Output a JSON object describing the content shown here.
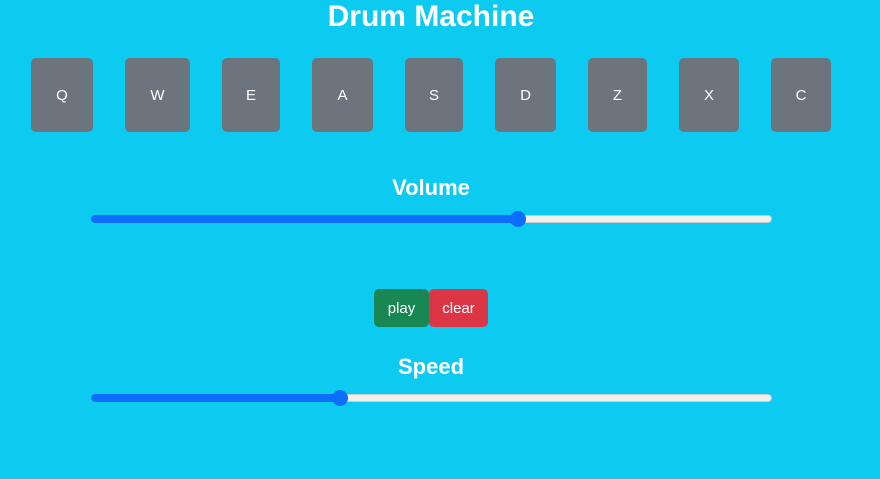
{
  "title": "Drum Machine",
  "pads": [
    {
      "key": "Q"
    },
    {
      "key": "W"
    },
    {
      "key": "E"
    },
    {
      "key": "A"
    },
    {
      "key": "S"
    },
    {
      "key": "D"
    },
    {
      "key": "Z"
    },
    {
      "key": "X"
    },
    {
      "key": "C"
    }
  ],
  "volume": {
    "label": "Volume",
    "value_fraction": 0.627
  },
  "controls": {
    "play_label": "play",
    "clear_label": "clear"
  },
  "speed": {
    "label": "Speed",
    "value_fraction": 0.366
  },
  "colors": {
    "background": "#0dcaf0",
    "pad": "#6c757d",
    "play": "#198754",
    "clear": "#dc3545",
    "slider_accent": "#0d6efd"
  }
}
